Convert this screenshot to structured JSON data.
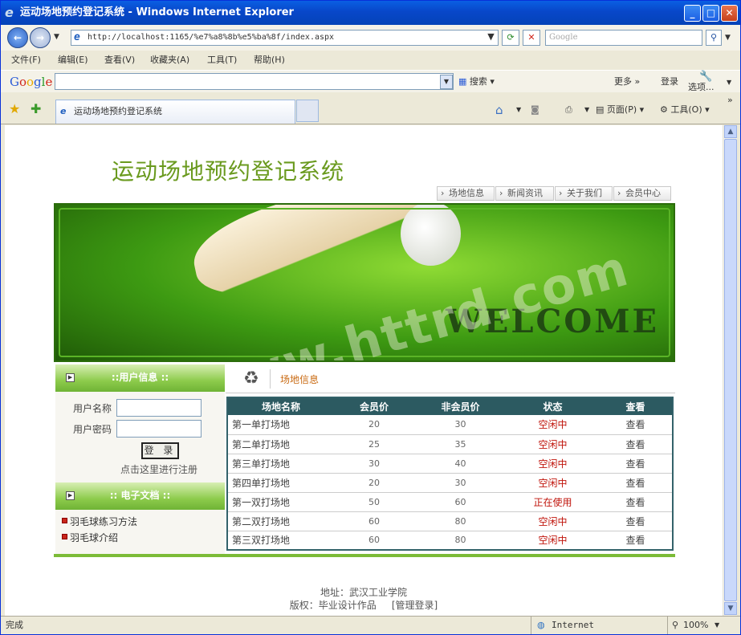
{
  "window": {
    "title": "运动场地预约登记系统 - Windows Internet Explorer"
  },
  "address": {
    "url": "http://localhost:1165/%e7%a8%8b%e5%ba%8f/index.aspx",
    "search_placeholder": "Google"
  },
  "menu": [
    "文件(F)",
    "编辑(E)",
    "查看(V)",
    "收藏夹(A)",
    "工具(T)",
    "帮助(H)"
  ],
  "google_bar": {
    "logo": "Google",
    "search_label": "搜索",
    "more_label": "更多 »",
    "login_label": "登录",
    "options_label": "选项..."
  },
  "tab": {
    "title": "运动场地预约登记系统"
  },
  "command_bar": {
    "page_label": "页面(P)",
    "tools_label": "工具(O)"
  },
  "site": {
    "title": "运动场地预约登记系统",
    "nav": [
      "场地信息",
      "新闻资讯",
      "关于我们",
      "会员中心"
    ],
    "banner_text": "WELCOME",
    "watermark": "www.httrd.com"
  },
  "user_box": {
    "header": "::用户信息 ::",
    "username_label": "用户名称",
    "password_label": "用户密码",
    "login_button": "登 录",
    "register_link": "点击这里进行注册"
  },
  "doc_box": {
    "header": ":: 电子文档 ::",
    "items": [
      "羽毛球练习方法",
      "羽毛球介绍"
    ]
  },
  "venues": {
    "title": "场地信息",
    "headers": [
      "场地名称",
      "会员价",
      "非会员价",
      "状态",
      "查看"
    ],
    "rows": [
      {
        "name": "第一单打场地",
        "member": "20",
        "nonmember": "30",
        "status": "空闲中",
        "view": "查看"
      },
      {
        "name": "第二单打场地",
        "member": "25",
        "nonmember": "35",
        "status": "空闲中",
        "view": "查看"
      },
      {
        "name": "第三单打场地",
        "member": "30",
        "nonmember": "40",
        "status": "空闲中",
        "view": "查看"
      },
      {
        "name": "第四单打场地",
        "member": "20",
        "nonmember": "30",
        "status": "空闲中",
        "view": "查看"
      },
      {
        "name": "第一双打场地",
        "member": "50",
        "nonmember": "60",
        "status": "正在使用",
        "view": "查看"
      },
      {
        "name": "第二双打场地",
        "member": "60",
        "nonmember": "80",
        "status": "空闲中",
        "view": "查看"
      },
      {
        "name": "第三双打场地",
        "member": "60",
        "nonmember": "80",
        "status": "空闲中",
        "view": "查看"
      }
    ]
  },
  "footer": {
    "address": "地址：武汉工业学院",
    "copyright": "版权：毕业设计作品",
    "admin_link": "[管理登录]"
  },
  "status": {
    "left": "完成",
    "zone": "Internet",
    "zoom": "100%"
  }
}
